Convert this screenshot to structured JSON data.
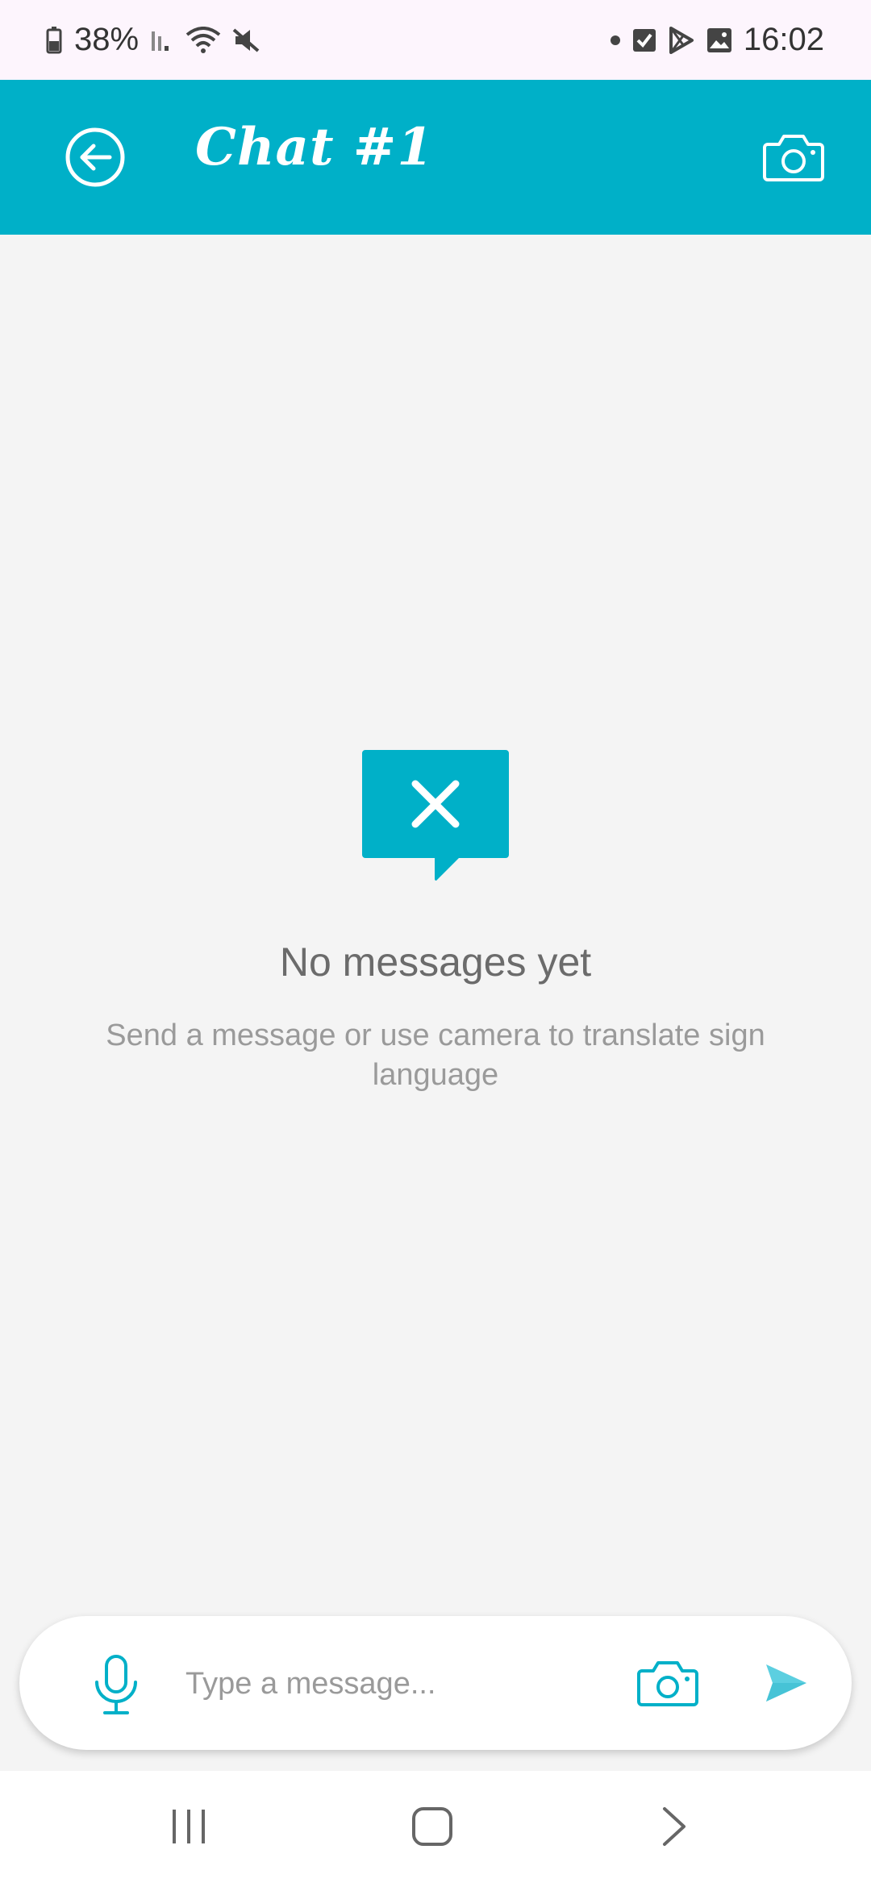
{
  "status_bar": {
    "battery": "38%",
    "time": "16:02",
    "icons": [
      "battery-icon",
      "signal-icon",
      "wifi-icon",
      "mute-icon",
      "notification-dot-icon",
      "checkbox-icon",
      "play-store-icon",
      "gallery-icon"
    ]
  },
  "header": {
    "title": "Chat #1",
    "back_icon": "back-arrow-icon",
    "camera_icon": "camera-icon"
  },
  "empty_state": {
    "icon": "message-x-icon",
    "title": "No messages yet",
    "subtitle": "Send a message or use camera to translate sign language"
  },
  "composer": {
    "placeholder": "Type a message...",
    "value": "",
    "mic_icon": "microphone-icon",
    "camera_icon": "camera-icon",
    "send_icon": "send-icon"
  },
  "nav_bar": {
    "icons": [
      "recent-apps-icon",
      "home-icon",
      "back-icon"
    ]
  },
  "colors": {
    "accent": "#00b0c8",
    "send": "#5ccfe0",
    "background": "#f4f4f4",
    "status_bar": "#fdf5fd"
  }
}
